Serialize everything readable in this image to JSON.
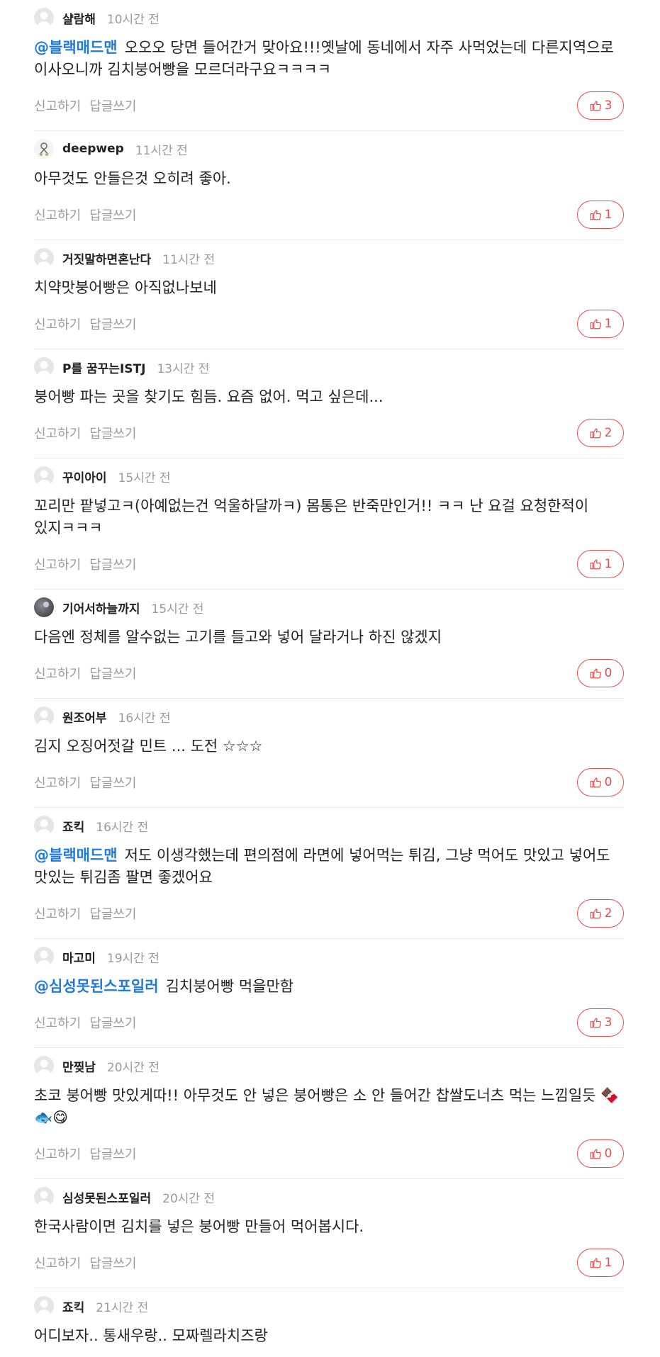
{
  "actions": {
    "report_label": "신고하기",
    "reply_label": "답글쓰기"
  },
  "colors": {
    "mention": "#1f7ae0",
    "like_border": "#e74c4c",
    "muted": "#9a9a9a"
  },
  "comments": [
    {
      "nickname": "샬람해",
      "time": "10시간 전",
      "avatar": "default-avatar-icon",
      "mention": "@블랙매드맨",
      "text": "오오오 당면 들어간거 맞아요!!!옛날에 동네에서 자주 사먹었는데 다른지역으로 이사오니까 김치붕어빵을 모르더라구요ㅋㅋㅋㅋ",
      "likes": "3"
    },
    {
      "nickname": "deepwep",
      "time": "11시간 전",
      "avatar": "character-avatar-icon",
      "mention": "",
      "text": "아무것도 안들은것 오히려 좋아.",
      "likes": "1"
    },
    {
      "nickname": "거짓말하면혼난다",
      "time": "11시간 전",
      "avatar": "default-avatar-icon",
      "mention": "",
      "text": "치약맛붕어빵은 아직없나보네",
      "likes": "1"
    },
    {
      "nickname": "P를 꿈꾸는ISTJ",
      "time": "13시간 전",
      "avatar": "default-avatar-icon",
      "mention": "",
      "text": "붕어빵 파는 곳을 찾기도 힘듬. 요즘 없어. 먹고 싶은데...",
      "likes": "2"
    },
    {
      "nickname": "꾸이아이",
      "time": "15시간 전",
      "avatar": "default-avatar-icon",
      "mention": "",
      "text": "꼬리만 팥넣고ㅋ(아예없는건 억울하달까ㅋ) 몸통은 반죽만인거!! ㅋㅋ 난 요걸 요청한적이 있지ㅋㅋㅋ",
      "likes": "1"
    },
    {
      "nickname": "기어서하늘까지",
      "time": "15시간 전",
      "avatar": "photo-avatar-icon",
      "mention": "",
      "text": "다음엔 정체를 알수없는 고기를 들고와 넣어 달라거나 하진 않겠지",
      "likes": "0"
    },
    {
      "nickname": "원조어부",
      "time": "16시간 전",
      "avatar": "default-avatar-icon",
      "mention": "",
      "text": "김지 오징어젓갈 민트 ... 도전 ☆☆☆",
      "likes": "0"
    },
    {
      "nickname": "죠킥",
      "time": "16시간 전",
      "avatar": "default-avatar-icon",
      "mention": "@블랙매드맨",
      "text": "저도 이생각했는데 편의점에 라면에 넣어먹는 튀김, 그냥 먹어도 맛있고 넣어도 맛있는 튀김좀 팔면 좋겠어요",
      "likes": "2"
    },
    {
      "nickname": "마고미",
      "time": "19시간 전",
      "avatar": "default-avatar-icon",
      "mention": "@심성못된스포일러",
      "text": "김치붕어빵 먹을만함",
      "likes": "3"
    },
    {
      "nickname": "만찢남",
      "time": "20시간 전",
      "avatar": "default-avatar-icon",
      "mention": "",
      "text": "초코 붕어빵 맛있게따!! 아무것도 안 넣은 붕어빵은 소 안 들어간 찹쌀도너츠 먹는 느낌일듯 🍫🐟😋",
      "likes": "0"
    },
    {
      "nickname": "심성못된스포일러",
      "time": "20시간 전",
      "avatar": "default-avatar-icon",
      "mention": "",
      "text": "한국사람이면 김치를 넣은 붕어빵 만들어 먹어봅시다.",
      "likes": "1"
    },
    {
      "nickname": "죠킥",
      "time": "21시간 전",
      "avatar": "default-avatar-icon",
      "mention": "",
      "text": "어디보자.. 통새우랑.. 모짜렐라치즈랑",
      "likes": ""
    }
  ]
}
